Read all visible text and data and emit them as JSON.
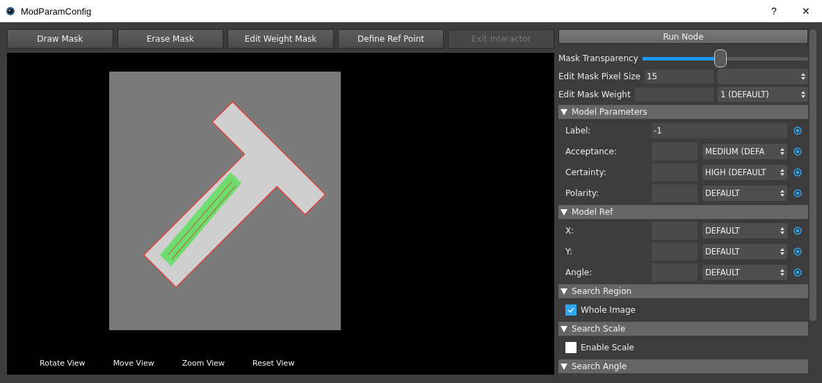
{
  "window": {
    "title": "ModParamConfig",
    "help": "?",
    "close": "✕"
  },
  "toolbar": [
    {
      "label": "Draw Mask",
      "disabled": false
    },
    {
      "label": "Erase Mask",
      "disabled": false
    },
    {
      "label": "Edit Weight Mask",
      "disabled": false
    },
    {
      "label": "Define Ref Point",
      "disabled": false
    },
    {
      "label": "Exit Interactor",
      "disabled": true
    }
  ],
  "viewer": {
    "view_buttons": [
      "Rotate View",
      "Move View",
      "Zoom View",
      "Reset View"
    ]
  },
  "panel": {
    "run_button": "Run Node",
    "slider": {
      "label": "Mask Transparency",
      "level": 0.47
    },
    "fields": [
      {
        "label": "Edit Mask Pixel Size",
        "value": "15"
      },
      {
        "label": "Edit Mask Weight",
        "select": "1 (DEFAULT)"
      }
    ],
    "sections": [
      {
        "title": "Model Parameters",
        "expanded": true,
        "rows": [
          {
            "kind": "text",
            "label": "Label:",
            "value": "-1"
          },
          {
            "kind": "combo",
            "label": "Acceptance:",
            "value": "",
            "select": "MEDIUM (DEFA"
          },
          {
            "kind": "combo",
            "label": "Certainty:",
            "value": "",
            "select": "HIGH (DEFAULT"
          },
          {
            "kind": "combo",
            "label": "Polarity:",
            "value": "",
            "select": "DEFAULT"
          }
        ]
      },
      {
        "title": "Model Ref",
        "expanded": true,
        "rows": [
          {
            "kind": "combo",
            "label": "X:",
            "value": "",
            "select": "DEFAULT"
          },
          {
            "kind": "combo",
            "label": "Y:",
            "value": "",
            "select": "DEFAULT"
          },
          {
            "kind": "combo",
            "label": "Angle:",
            "value": "",
            "select": "DEFAULT"
          }
        ]
      },
      {
        "title": "Search Region",
        "expanded": true,
        "rows": [
          {
            "kind": "checkbox",
            "label": "Whole Image",
            "checked": true
          }
        ]
      },
      {
        "title": "Search Scale",
        "expanded": true,
        "rows": [
          {
            "kind": "checkbox",
            "label": "Enable Scale",
            "checked": false
          }
        ]
      },
      {
        "title": "Search Angle",
        "expanded": true
      }
    ]
  }
}
